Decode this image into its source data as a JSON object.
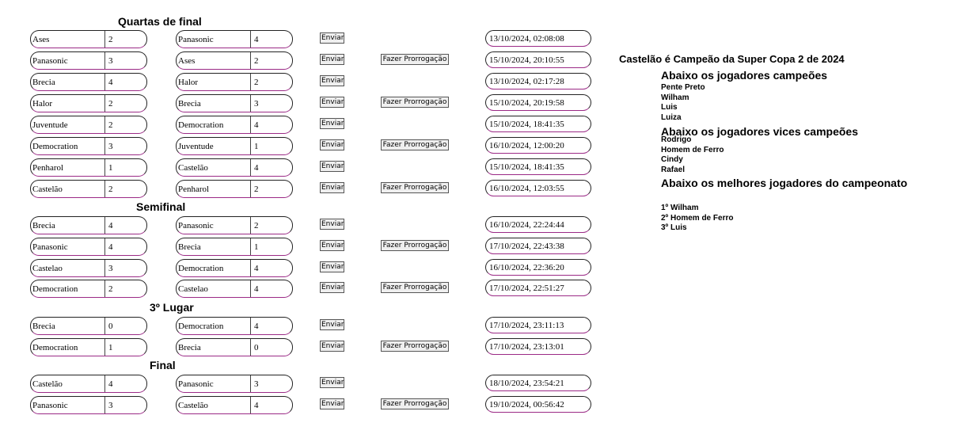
{
  "actions": {
    "send_label": "Enviar",
    "overtime_label": "Fazer Prorrogação"
  },
  "sections": [
    {
      "title": "Quartas de final",
      "matches": [
        {
          "home": "Ases",
          "home_score": "2",
          "away": "Panasonic",
          "away_score": "4",
          "overtime": false,
          "timestamp": "13/10/2024, 02:08:08"
        },
        {
          "home": "Panasonic",
          "home_score": "3",
          "away": "Ases",
          "away_score": "2",
          "overtime": true,
          "timestamp": "15/10/2024, 20:10:55"
        },
        {
          "home": "Brecia",
          "home_score": "4",
          "away": "Halor",
          "away_score": "2",
          "overtime": false,
          "timestamp": "13/10/2024, 02:17:28"
        },
        {
          "home": "Halor",
          "home_score": "2",
          "away": "Brecia",
          "away_score": "3",
          "overtime": true,
          "timestamp": "15/10/2024, 20:19:58"
        },
        {
          "home": "Juventude",
          "home_score": "2",
          "away": "Democration",
          "away_score": "4",
          "overtime": false,
          "timestamp": "15/10/2024, 18:41:35"
        },
        {
          "home": "Democration",
          "home_score": "3",
          "away": "Juventude",
          "away_score": "1",
          "overtime": true,
          "timestamp": "16/10/2024, 12:00:20"
        },
        {
          "home": "Penharol",
          "home_score": "1",
          "away": "Castelão",
          "away_score": "4",
          "overtime": false,
          "timestamp": "15/10/2024, 18:41:35"
        },
        {
          "home": "Castelão",
          "home_score": "2",
          "away": "Penharol",
          "away_score": "2",
          "overtime": true,
          "timestamp": "16/10/2024, 12:03:55"
        }
      ]
    },
    {
      "title": "Semifinal",
      "matches": [
        {
          "home": "Brecia",
          "home_score": "4",
          "away": "Panasonic",
          "away_score": "2",
          "overtime": false,
          "timestamp": "16/10/2024, 22:24:44"
        },
        {
          "home": "Panasonic",
          "home_score": "4",
          "away": "Brecia",
          "away_score": "1",
          "overtime": true,
          "timestamp": "17/10/2024, 22:43:38"
        },
        {
          "home": "Castelao",
          "home_score": "3",
          "away": "Democration",
          "away_score": "4",
          "overtime": false,
          "timestamp": "16/10/2024, 22:36:20"
        },
        {
          "home": "Democration",
          "home_score": "2",
          "away": "Castelao",
          "away_score": "4",
          "overtime": true,
          "timestamp": "17/10/2024, 22:51:27"
        }
      ]
    },
    {
      "title": "3º Lugar",
      "matches": [
        {
          "home": "Brecia",
          "home_score": "0",
          "away": "Democration",
          "away_score": "4",
          "overtime": false,
          "timestamp": "17/10/2024, 23:11:13"
        },
        {
          "home": "Democration",
          "home_score": "1",
          "away": "Brecia",
          "away_score": "0",
          "overtime": true,
          "timestamp": "17/10/2024, 23:13:01"
        }
      ]
    },
    {
      "title": "Final",
      "matches": [
        {
          "home": "Castelão",
          "home_score": "4",
          "away": "Panasonic",
          "away_score": "3",
          "overtime": false,
          "timestamp": "18/10/2024, 23:54:21"
        },
        {
          "home": "Panasonic",
          "home_score": "3",
          "away": "Castelão",
          "away_score": "4",
          "overtime": true,
          "timestamp": "19/10/2024, 00:56:42"
        }
      ]
    }
  ],
  "summary": {
    "champion_title": "Castelão é Campeão da Super Copa 2 de 2024",
    "champions_heading": "Abaixo os jogadores campeões",
    "champions": [
      "Pente Preto",
      "Wilham",
      "Luis",
      "Luiza"
    ],
    "vice_heading": "Abaixo os jogadores vices campeões",
    "vice": [
      "Rodrigo",
      "Homem de Ferro",
      "Cindy",
      "Rafael"
    ],
    "best_heading": "Abaixo os melhores jogadores do campeonato",
    "best": [
      "1º Wilham",
      "2º Homem de Ferro",
      "3º Luis"
    ]
  }
}
